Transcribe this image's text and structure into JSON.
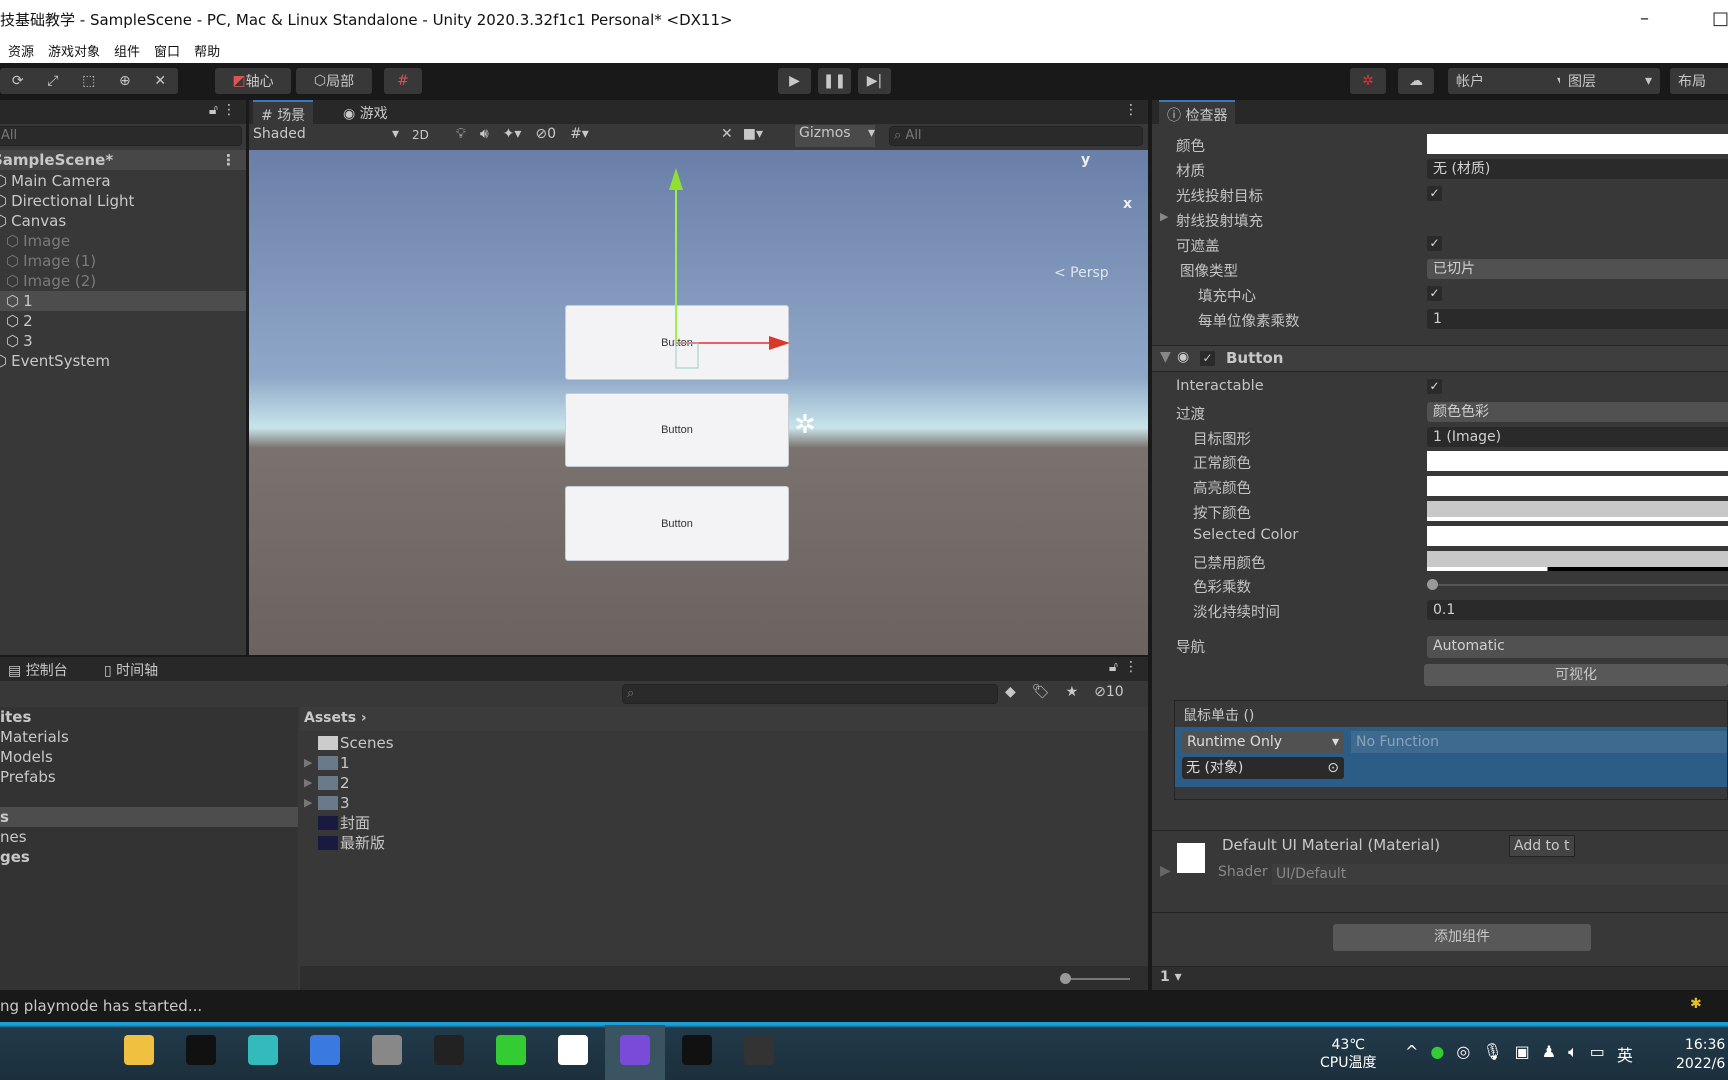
{
  "window": {
    "title": "技基础教学 - SampleScene - PC, Mac & Linux Standalone - Unity 2020.3.32f1c1 Personal* <DX11>",
    "menu": [
      "资源",
      "游戏对象",
      "组件",
      "窗口",
      "帮助"
    ]
  },
  "toolbar": {
    "pivot": "轴心",
    "local": "局部",
    "account": "帐户",
    "layers": "图层",
    "layout": "布局"
  },
  "hierarchy": {
    "search": "All",
    "scene": "SampleScene*",
    "items": [
      {
        "name": "Main Camera",
        "indent": 0,
        "dim": false,
        "selected": false
      },
      {
        "name": "Directional Light",
        "indent": 0,
        "dim": false,
        "selected": false
      },
      {
        "name": "Canvas",
        "indent": 0,
        "dim": false,
        "selected": false
      },
      {
        "name": "Image",
        "indent": 1,
        "dim": true,
        "selected": false
      },
      {
        "name": "Image (1)",
        "indent": 1,
        "dim": true,
        "selected": false
      },
      {
        "name": "Image (2)",
        "indent": 1,
        "dim": true,
        "selected": false
      },
      {
        "name": "1",
        "indent": 1,
        "dim": false,
        "selected": true
      },
      {
        "name": "2",
        "indent": 1,
        "dim": false,
        "selected": false
      },
      {
        "name": "3",
        "indent": 1,
        "dim": false,
        "selected": false
      },
      {
        "name": "EventSystem",
        "indent": 0,
        "dim": false,
        "selected": false
      }
    ]
  },
  "scene": {
    "tab_scene": "场景",
    "tab_game": "游戏",
    "shading": "Shaded",
    "mode2d": "2D",
    "hidden_count": "0",
    "gizmos": "Gizmos",
    "search": "All",
    "persp": "< Persp",
    "axis_y": "y",
    "axis_x": "x",
    "buttons": [
      "Button",
      "Button",
      "Button"
    ]
  },
  "inspector": {
    "tab": "检查器",
    "image_rows": [
      {
        "label": "颜色",
        "type": "color",
        "indent": 0
      },
      {
        "label": "材质",
        "type": "field",
        "value": "无 (材质)",
        "indent": 0
      },
      {
        "label": "光线投射目标",
        "type": "check",
        "indent": 0
      },
      {
        "label": "射线投射填充",
        "type": "fold",
        "indent": 0
      },
      {
        "label": "可遮盖",
        "type": "check",
        "indent": 0
      },
      {
        "label": "图像类型",
        "type": "drop",
        "value": "已切片",
        "indent": 1
      },
      {
        "label": "填充中心",
        "type": "check",
        "indent": 2
      },
      {
        "label": "每单位像素乘数",
        "type": "field",
        "value": "1",
        "indent": 2
      }
    ],
    "button_component": "Button",
    "button_rows": [
      {
        "label": "Interactable",
        "type": "check",
        "indent": 0
      },
      {
        "label": "过渡",
        "type": "drop",
        "value": "颜色色彩",
        "indent": 0
      },
      {
        "label": "目标图形",
        "type": "field",
        "value": "1 (Image)",
        "indent": 1
      },
      {
        "label": "正常颜色",
        "type": "color",
        "indent": 1
      },
      {
        "label": "高亮颜色",
        "type": "color",
        "indent": 1
      },
      {
        "label": "按下颜色",
        "type": "gray",
        "indent": 1
      },
      {
        "label": "Selected Color",
        "type": "color",
        "indent": 1
      },
      {
        "label": "已禁用颜色",
        "type": "disabled",
        "indent": 1
      },
      {
        "label": "色彩乘数",
        "type": "slider",
        "value": 1,
        "indent": 1
      },
      {
        "label": "淡化持续时间",
        "type": "field",
        "value": "0.1",
        "indent": 1
      }
    ],
    "navigation_label": "导航",
    "navigation": "Automatic",
    "visualize": "可视化",
    "onclick": {
      "title": "鼠标单击 ()",
      "runtime": "Runtime Only",
      "function": "No Function",
      "object": "无 (对象)"
    },
    "tooltip": "Add to t",
    "material": {
      "name": "Default UI Material (Material)",
      "shader_label": "Shader",
      "shader": "UI/Default"
    },
    "add_component": "添加组件",
    "footer": "1"
  },
  "bottom": {
    "tab_console": "控制台",
    "tab_timeline": "时间轴",
    "hidden_count": "10",
    "tree": [
      {
        "t": "ites",
        "b": true
      },
      {
        "t": "Materials"
      },
      {
        "t": "Models"
      },
      {
        "t": "Prefabs"
      },
      {
        "t": ""
      },
      {
        "t": "s",
        "b": true,
        "sel": true
      },
      {
        "t": "nes"
      },
      {
        "t": "ges",
        "b": true
      }
    ],
    "breadcrumb": "Assets",
    "assets": [
      {
        "name": "Scenes",
        "kind": "folder"
      },
      {
        "name": "1",
        "kind": "scene"
      },
      {
        "name": "2",
        "kind": "scene"
      },
      {
        "name": "3",
        "kind": "scene"
      },
      {
        "name": "封面",
        "kind": "image"
      },
      {
        "name": "最新版",
        "kind": "image"
      }
    ]
  },
  "status": {
    "message": "ng playmode has started..."
  },
  "taskbar": {
    "temp": "43℃",
    "temp_label": "CPU温度",
    "ime": "英",
    "time": "16:36",
    "date": "2022/6"
  },
  "colors": {
    "accent": "#3a79bb",
    "selection": "#2c5d87"
  }
}
